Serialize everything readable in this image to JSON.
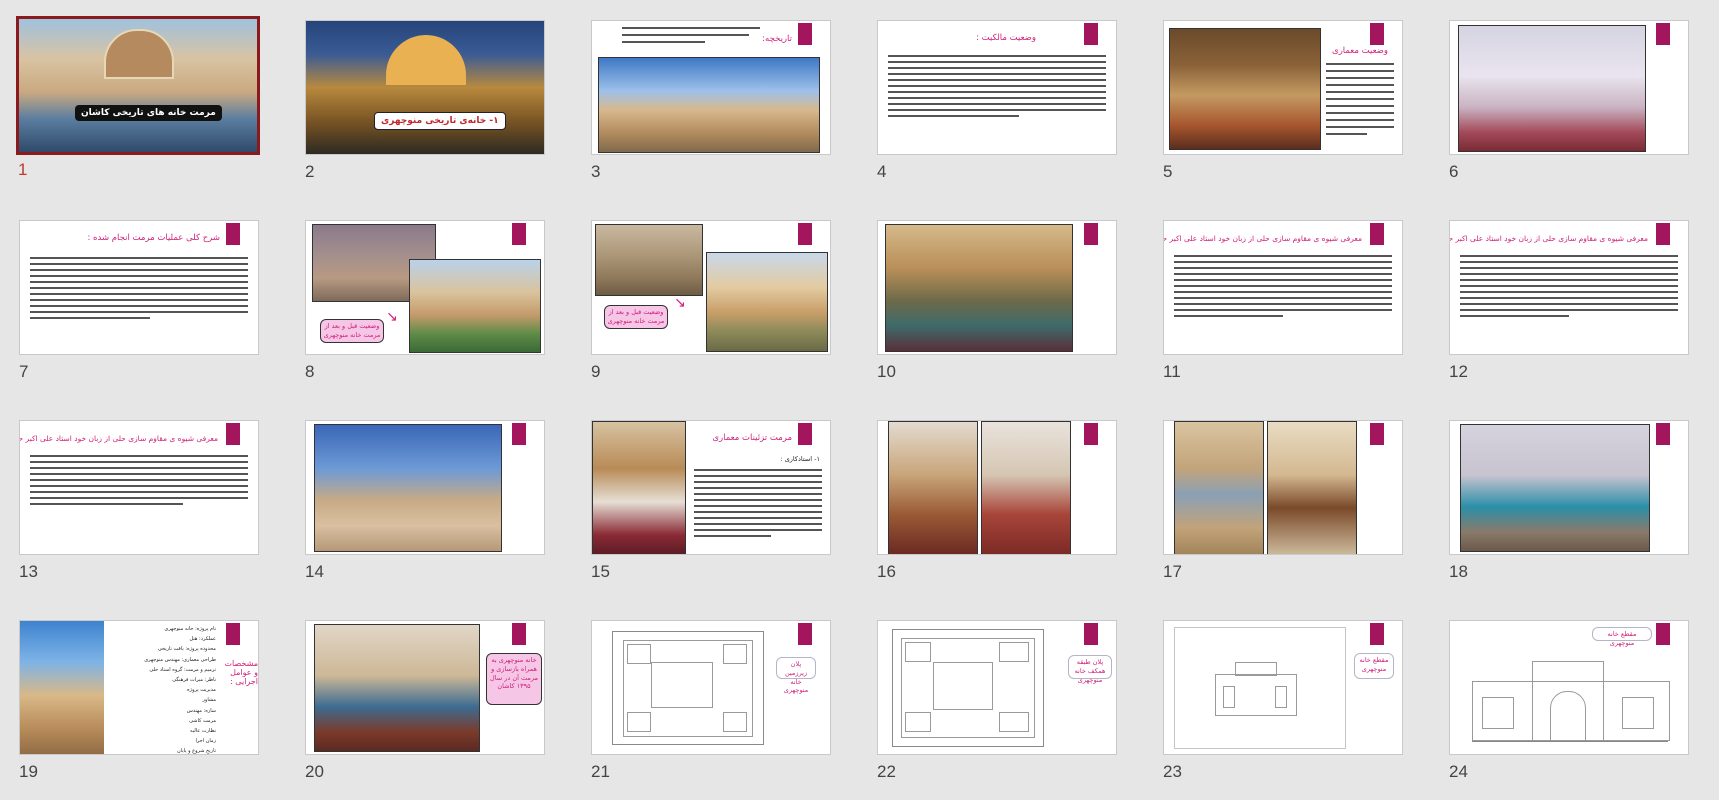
{
  "colors": {
    "background": "#e6e6e6",
    "accent_magenta": "#a3165e",
    "heading_pink": "#d0207a",
    "selected_border": "#8b1a1f",
    "selected_number": "#c0392b"
  },
  "slides": [
    {
      "number": "1",
      "selected": true,
      "title": "مرمت خانه های تاریخی کاشان"
    },
    {
      "number": "2",
      "title": "۱- خانه‌ی تاریخی منوچهری"
    },
    {
      "number": "3",
      "heading": "تاریخچه:"
    },
    {
      "number": "4",
      "heading": "وضعیت مالکیت :"
    },
    {
      "number": "5",
      "heading": "وضعیت معماری"
    },
    {
      "number": "6"
    },
    {
      "number": "7",
      "heading": "شرح کلی عملیات مرمت انجام شده :"
    },
    {
      "number": "8",
      "caption": "وضعیت قبل و بعد از مرمت خانه منوچهری"
    },
    {
      "number": "9",
      "caption": "وضعیت قبل و بعد از مرمت خانه منوچهری"
    },
    {
      "number": "10"
    },
    {
      "number": "11",
      "heading": "معرفی شیوه ی مقاوم سازی حلی از زبان خود استاد علی اکبر حلی :"
    },
    {
      "number": "12",
      "heading": "معرفی شیوه ی مقاوم سازی حلی از زبان خود استاد علی اکبر حلی :"
    },
    {
      "number": "13",
      "heading": "معرفی شیوه ی مقاوم سازی حلی از زبان خود استاد علی اکبر حلی :"
    },
    {
      "number": "14"
    },
    {
      "number": "15",
      "heading": "مرمت تزئینات معماری",
      "subheading": "۱- استادکاری :"
    },
    {
      "number": "16"
    },
    {
      "number": "17"
    },
    {
      "number": "18"
    },
    {
      "number": "19",
      "heading": "مشخصات و عوامل اجرایی :",
      "bullets": [
        "نام پروژه: خانه منوچهری",
        "عملکرد: هتل",
        "محدوده پروژه: بافت تاریخی",
        "طراحی معماری: مهندس منوچهری",
        "ترمیم و مرمت: گروه استاد حلی",
        "ناظر: میراث فرهنگی",
        "مدیریت پروژه",
        "مشاور",
        "سازه: مهندس",
        "مرمت کاشی",
        "نظارت عالیه",
        "زمان اجرا",
        "تاریخ شروع و پایان"
      ]
    },
    {
      "number": "20",
      "caption": "خانه منوچهری به همراه بازسازی و مرمت آن در سال ۱۳۹۵ کاشان"
    },
    {
      "number": "21",
      "caption": "پلان زیرزمین خانه منوچهری"
    },
    {
      "number": "22",
      "caption": "پلان طبقه همکف خانه منوچهری"
    },
    {
      "number": "23",
      "caption": "مقطع خانه منوچهری"
    },
    {
      "number": "24",
      "caption": "مقطع خانه منوچهری"
    }
  ]
}
